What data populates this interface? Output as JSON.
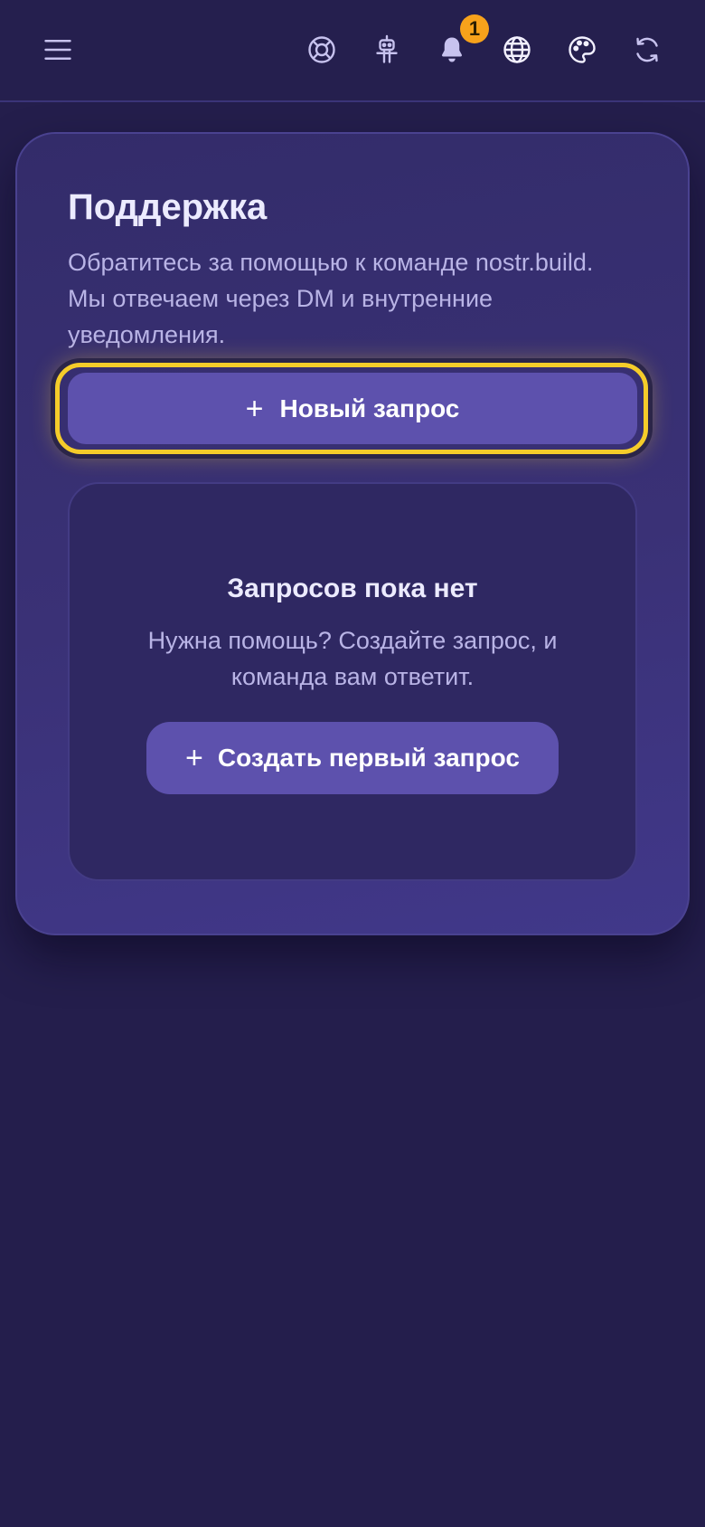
{
  "header": {
    "menu_icon": "hamburger-menu-icon",
    "icons": [
      "lifebuoy-icon",
      "robot-icon",
      "bell-icon",
      "globe-icon",
      "palette-icon",
      "refresh-icon"
    ],
    "notification_count": "1",
    "badge_color": "#f7a21b"
  },
  "support": {
    "title": "Поддержка",
    "description": "Обратитесь за помощью к команде nostr.build. Мы отвечаем через DM и внутренние уведомления.",
    "new_request_label": "Новый запрос",
    "plus_icon": "+"
  },
  "empty_state": {
    "title": "Запросов пока нет",
    "description": "Нужна помощь? Создайте запрос, и команда вам ответит.",
    "create_first_label": "Создать первый запрос",
    "plus_icon": "+"
  },
  "colors": {
    "background": "#241e4c",
    "card": "#3a3176",
    "accent_button": "#5d51ad",
    "focus_ring": "#f5cc2a"
  }
}
